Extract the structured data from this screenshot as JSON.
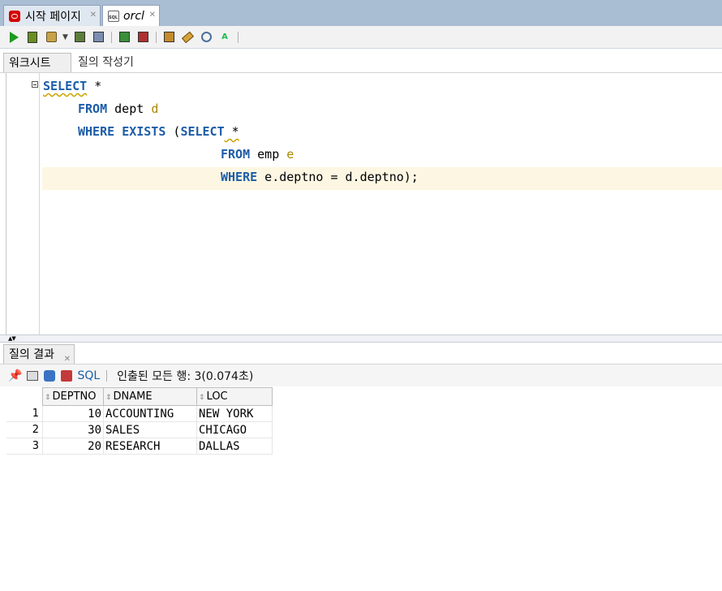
{
  "doc_tabs": [
    {
      "label": "시작 페이지",
      "icon": "oracle-icon"
    },
    {
      "label": "orcl",
      "icon": "sql-worksheet-icon"
    }
  ],
  "sub_tabs": {
    "worksheet": "워크시트",
    "query_builder": "질의 작성기"
  },
  "editor": {
    "lines": {
      "l1_kw": "SELECT",
      "l1_rest": " *",
      "l2_kw": "FROM",
      "l2_tbl": " dept ",
      "l2_alias": "d",
      "l3_kw1": "WHERE",
      "l3_kw2": "EXISTS",
      "l3_paren": " (",
      "l3_kw3": "SELECT",
      "l3_rest": " *",
      "l4_kw": "FROM",
      "l4_tbl": " emp ",
      "l4_alias": "e",
      "l5_kw": "WHERE",
      "l5_rest": " e.deptno = d.deptno);"
    },
    "highlight_color": "#fdf6e2"
  },
  "results": {
    "tab_label": "질의 결과",
    "sql_label": "SQL",
    "status": "인출된 모든 행: 3(0.074초)",
    "columns": [
      "DEPTNO",
      "DNAME",
      "LOC"
    ],
    "rows": [
      {
        "n": "1",
        "deptno": "10",
        "dname": "ACCOUNTING",
        "loc": "NEW YORK"
      },
      {
        "n": "2",
        "deptno": "30",
        "dname": "SALES",
        "loc": "CHICAGO"
      },
      {
        "n": "3",
        "deptno": "20",
        "dname": "RESEARCH",
        "loc": "DALLAS"
      }
    ]
  },
  "colors": {
    "keyword": "#1c5ca8",
    "alias": "#aa8800",
    "tab_bar": "#a9bdd3"
  }
}
